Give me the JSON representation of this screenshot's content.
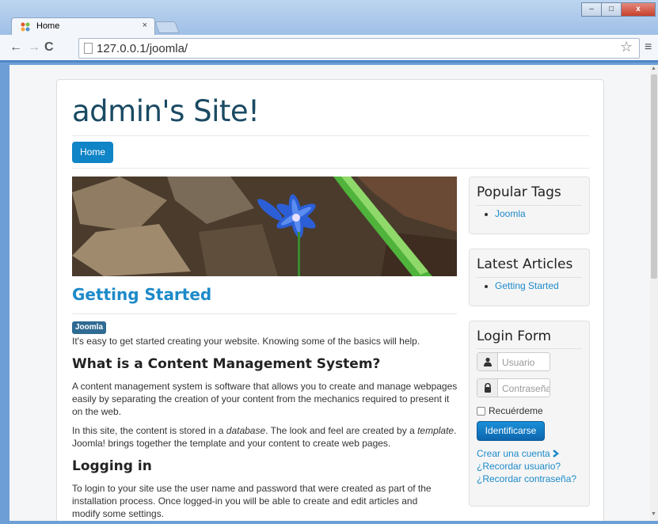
{
  "browser": {
    "tab_title": "Home",
    "tab_close": "×",
    "url": "127.0.0.1/joomla/",
    "window_buttons": {
      "minimize": "–",
      "maximize": "□",
      "close": "x"
    },
    "nav": {
      "back": "←",
      "forward": "→",
      "reload": "C"
    }
  },
  "site": {
    "title": "admin's Site!",
    "nav_home": "Home"
  },
  "article": {
    "title": "Getting Started",
    "tag": "Joomla",
    "intro": "It's easy to get started creating your website. Knowing some of the basics will help.",
    "heading1": "What is a Content Management System?",
    "para1": "A content management system is software that allows you to create and manage webpages easily by separating the creation of your content from the mechanics required to present it on the web.",
    "para2_a": "In this site, the content is stored in a ",
    "para2_em1": "database",
    "para2_b": ". The look and feel are created by a ",
    "para2_em2": "template",
    "para2_c": ". Joomla! brings together the template and your content to create web pages.",
    "heading2": "Logging in",
    "para3": "To login to your site use the user name and password that were created as part of the installation process. Once logged-in you will be able to create and edit articles and modify some settings."
  },
  "sidebar": {
    "popular_tags": {
      "title": "Popular Tags",
      "items": [
        "Joomla"
      ]
    },
    "latest_articles": {
      "title": "Latest Articles",
      "items": [
        "Getting Started"
      ]
    },
    "login": {
      "title": "Login Form",
      "username_placeholder": "Usuario",
      "password_placeholder": "Contraseña",
      "remember_label": "Recuérdeme",
      "submit_label": "Identificarse",
      "create_account": "Crear una cuenta",
      "forgot_username": "¿Recordar usuario?",
      "forgot_password": "¿Recordar contraseña?"
    }
  },
  "colors": {
    "accent": "#0f84c6",
    "link": "#1d8ac9",
    "title": "#1a4a63",
    "tag": "#2f6b93"
  }
}
